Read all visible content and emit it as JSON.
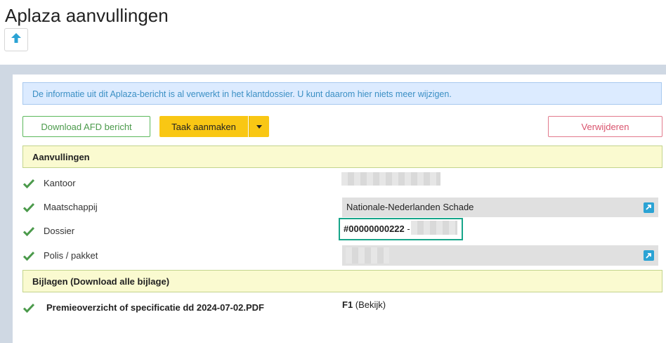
{
  "page": {
    "title": "Aplaza aanvullingen"
  },
  "alert": {
    "text": "De informatie uit dit Aplaza-bericht is al verwerkt in het klantdossier. U kunt daarom hier niets meer wijzigen."
  },
  "toolbar": {
    "download_label": "Download AFD bericht",
    "task_label": "Taak aanmaken",
    "delete_label": "Verwijderen"
  },
  "aanvullingen": {
    "title": "Aanvullingen",
    "rows": [
      {
        "label": "Kantoor",
        "value": ""
      },
      {
        "label": "Maatschappij",
        "value": "Nationale-Nederlanden Schade"
      },
      {
        "label": "Dossier",
        "value_number": "#00000000222",
        "value_separator": " -"
      },
      {
        "label": "Polis / pakket",
        "value": ""
      }
    ]
  },
  "bijlagen": {
    "title": "Bijlagen (Download alle bijlage)",
    "items": [
      {
        "name": "Premieoverzicht of specificatie dd 2024-07-02.PDF",
        "code": "F1",
        "link": "(Bekijk)"
      }
    ]
  },
  "icons": {
    "up": "arrow-up-icon",
    "check": "checkmark-icon",
    "external": "external-link-icon",
    "caret": "caret-down-icon"
  },
  "colors": {
    "accent_blue": "#2ba3d4",
    "warning_yellow": "#f9c714",
    "success_green": "#5cb85c",
    "danger_pink": "#d9536d",
    "highlight_teal": "#17a58a"
  }
}
